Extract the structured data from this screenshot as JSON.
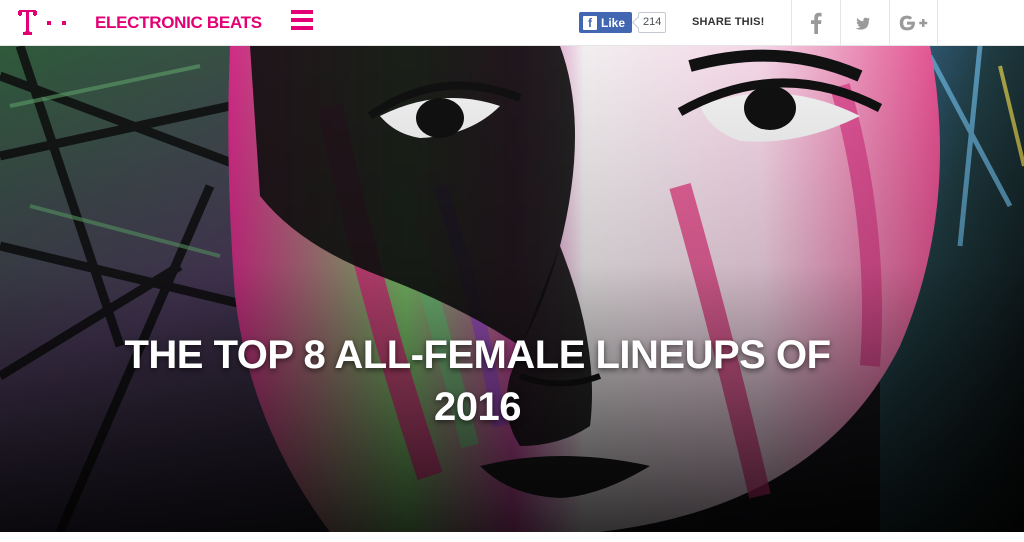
{
  "header": {
    "logo_icon": "telekom-t-logo-icon",
    "brand": "ELECTRONIC BEATS",
    "menu_icon": "hamburger-menu-icon",
    "brand_color": "#e20074"
  },
  "facebook": {
    "like_label": "Like",
    "like_count": "214",
    "icon": "facebook-f-icon",
    "color": "#4267b2"
  },
  "share": {
    "label": "SHARE THIS!",
    "buttons": [
      {
        "name": "facebook",
        "icon": "facebook-icon"
      },
      {
        "name": "twitter",
        "icon": "twitter-icon"
      },
      {
        "name": "google-plus",
        "icon": "google-plus-icon"
      }
    ],
    "icon_color": "#9a9a9a"
  },
  "hero": {
    "title": "THE TOP 8 ALL-FEMALE LINEUPS OF 2016",
    "image": "painted-woman-face-artwork"
  }
}
